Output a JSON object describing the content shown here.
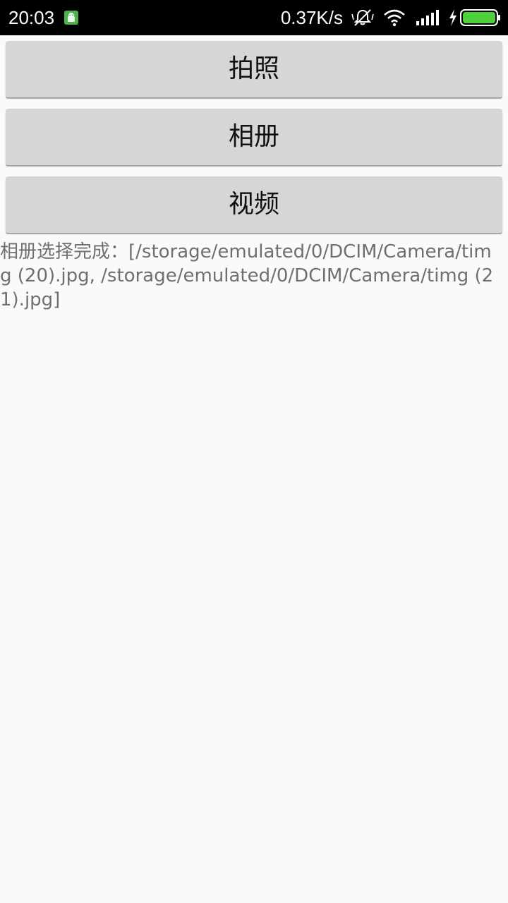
{
  "status_bar": {
    "time": "20:03",
    "net_speed": "0.37K/s",
    "icons": [
      "android-app-icon",
      "silent-vibrate-icon",
      "wifi-icon",
      "signal-icon",
      "charging-icon",
      "battery-icon"
    ],
    "battery_color": "#4cd13a",
    "app_icon_color": "#4caf50"
  },
  "buttons": {
    "camera_label": "拍照",
    "album_label": "相册",
    "video_label": "视频"
  },
  "result": {
    "text": "相册选择完成：[/storage/emulated/0/DCIM/Camera/timg (20).jpg, /storage/emulated/0/DCIM/Camera/timg (21).jpg]"
  }
}
